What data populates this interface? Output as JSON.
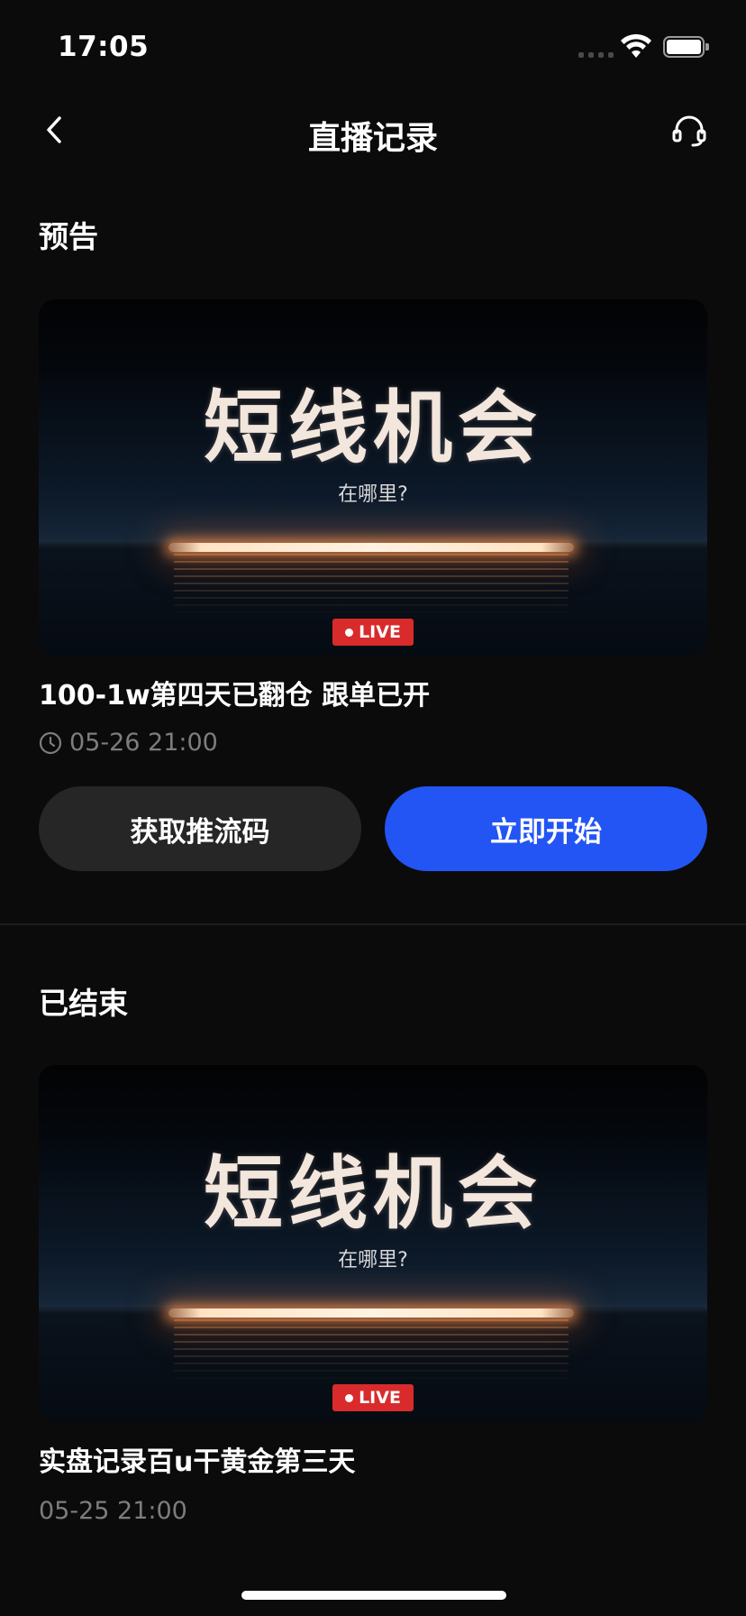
{
  "status_bar": {
    "time": "17:05"
  },
  "nav": {
    "title": "直播记录"
  },
  "upcoming": {
    "section_title": "预告",
    "item": {
      "thumbnail_headline": "短线机会",
      "thumbnail_subline": "在哪里?",
      "live_label": "LIVE",
      "title": "100-1w第四天已翻仓 跟单已开",
      "time": "05-26 21:00"
    },
    "buttons": {
      "stream_key": "获取推流码",
      "start_now": "立即开始"
    }
  },
  "ended": {
    "section_title": "已结束",
    "item": {
      "thumbnail_headline": "短线机会",
      "thumbnail_subline": "在哪里?",
      "live_label": "LIVE",
      "title": "实盘记录百u干黄金第三天",
      "time": "05-25 21:00"
    }
  },
  "colors": {
    "background": "#0b0b0b",
    "primary": "#2355f5",
    "secondary": "#262626",
    "live": "#d92b2b",
    "muted_text": "#7d7d7d"
  },
  "icons": [
    "back-chevron-icon",
    "headset-icon",
    "clock-icon",
    "wifi-icon",
    "battery-icon"
  ]
}
